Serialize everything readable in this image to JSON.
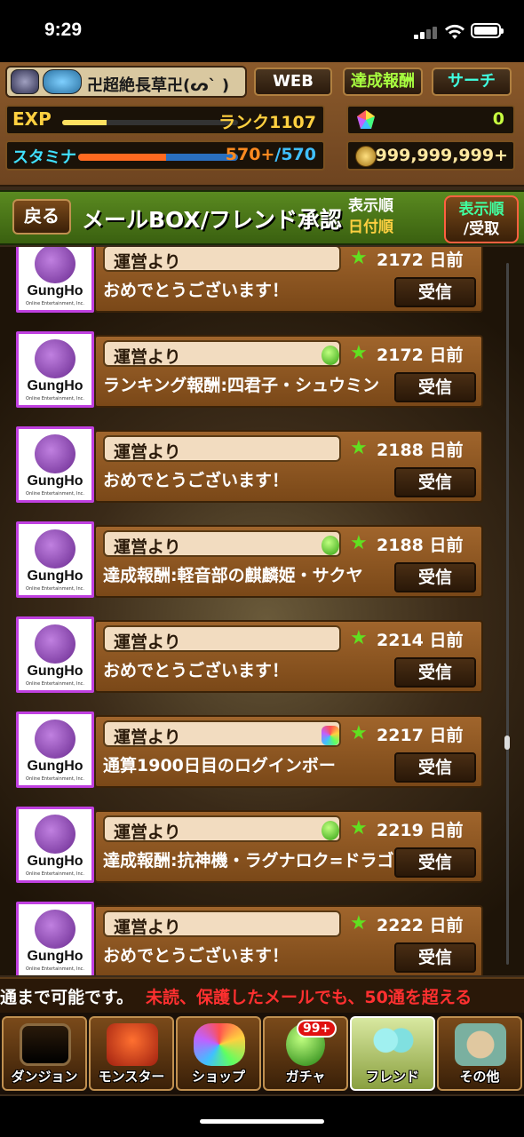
{
  "status_bar": {
    "time": "9:29",
    "signal_icon": "cellular-signal-icon",
    "wifi_icon": "wifi-icon",
    "battery_icon": "battery-icon"
  },
  "header": {
    "player_name": "卍超絶長草卍(ᔕ` )",
    "buttons": {
      "web": "WEB",
      "achievements": "達成報酬",
      "search": "サーチ"
    },
    "exp_label": "EXP",
    "exp_progress": 0.25,
    "rank": "ランク1107",
    "stamina_label": "スタミナ",
    "stamina_current": "570+",
    "stamina_max": "/570",
    "stamina_progress": 0.55,
    "magic_stones": "0",
    "coins": "999,999,999+"
  },
  "titlebar": {
    "back": "戻る",
    "title": "メールBOX/フレンド承認",
    "sort_line1": "表示順",
    "sort_line2": "日付順",
    "sort_button_line1": "表示順",
    "sort_button_line2": "/受取"
  },
  "mails": [
    {
      "sender": "運営より",
      "subject": "おめでとうございます！",
      "days": "2172 日前",
      "attachment": "none",
      "action": "受信"
    },
    {
      "sender": "運営より",
      "subject": "ランキング報酬:四君子・シュウミン",
      "days": "2172 日前",
      "attachment": "egg",
      "action": "受信"
    },
    {
      "sender": "運営より",
      "subject": "おめでとうございます！",
      "days": "2188 日前",
      "attachment": "none",
      "action": "受信"
    },
    {
      "sender": "運営より",
      "subject": "達成報酬:軽音部の麒麟姫・サクヤ",
      "days": "2188 日前",
      "attachment": "egg",
      "action": "受信"
    },
    {
      "sender": "運営より",
      "subject": "おめでとうございます！",
      "days": "2214 日前",
      "attachment": "none",
      "action": "受信"
    },
    {
      "sender": "運営より",
      "subject": "通算1900日目のログインボー",
      "days": "2217 日前",
      "attachment": "stone",
      "action": "受信"
    },
    {
      "sender": "運営より",
      "subject": "達成報酬:抗神機・ラグナロク=ドラゴン",
      "days": "2219 日前",
      "attachment": "egg",
      "action": "受信"
    },
    {
      "sender": "運営より",
      "subject": "おめでとうございます！",
      "days": "2222 日前",
      "attachment": "none",
      "action": "受信"
    }
  ],
  "logo": {
    "text": "GungHo",
    "subtext": "Online Entertainment, Inc."
  },
  "ticker": {
    "white": "通まで可能です。",
    "red": "未読、保護したメールでも、50通を超える"
  },
  "nav": [
    {
      "label": "ダンジョン",
      "icon": "dungeon-gate-icon"
    },
    {
      "label": "モンスター",
      "icon": "dragon-icon"
    },
    {
      "label": "ショップ",
      "icon": "rainbow-stone-icon"
    },
    {
      "label": "ガチャ",
      "icon": "egg-icon",
      "badge": "99+"
    },
    {
      "label": "フレンド",
      "icon": "friends-icon"
    },
    {
      "label": "その他",
      "icon": "question-icon"
    }
  ]
}
